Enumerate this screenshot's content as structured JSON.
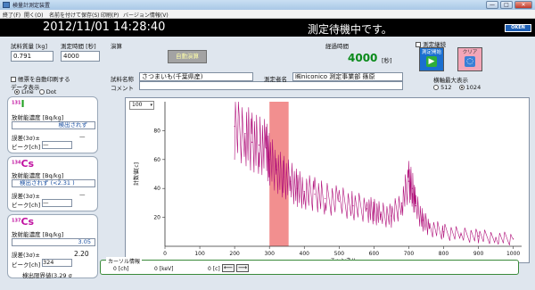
{
  "window": {
    "title": "検量計測定装置",
    "min_label": "—",
    "max_label": "□",
    "close_label": "✕"
  },
  "menu": [
    "終了(F)",
    "開く(O)",
    "名前を付けて保存(S)",
    "印刷(P)",
    "バージョン情報(V)"
  ],
  "banner": {
    "datetime": "2012/11/01 14:28:40",
    "status": "測定待機中です。",
    "logo": "OKEN"
  },
  "inputs": {
    "sample_mass_label": "試料質量 [kg]",
    "sample_mass_value": "0.791",
    "meas_time_label": "測定時間 [秒]",
    "meas_time_value": "4000",
    "calc_label": "演算",
    "auto_calc_button": "自動演算",
    "elapsed_label": "経過時間",
    "elapsed_value": "4000",
    "elapsed_unit": "[秒]",
    "continuous_label": "測定継続",
    "start_button": "測定開始",
    "clear_button": "クリア",
    "auto_save_label": "帳票を自動印刷する",
    "data_display_label": "データ表示",
    "line_label": "Line",
    "dot_label": "Dot",
    "sample_name_label": "試料名称",
    "sample_name_value": "さつまいも(千葉県産)",
    "operator_label": "測定者名",
    "operator_value": "㈱niconico 測定事業部 篠原",
    "comment_label": "コメント",
    "comment_value": "",
    "axis_max_label": "横軸最大表示",
    "axis_512": "512",
    "axis_1024": "1024"
  },
  "isotopes": [
    {
      "mass": "131",
      "element": "I",
      "conc_label": "放射能濃度 [Bq/kg]",
      "conc_value": "検出されず",
      "err_label": "誤差(3σ)±",
      "err_value": "—",
      "peak_label": "ピーク[ch]",
      "peak_value": "—",
      "color": "#20a020"
    },
    {
      "mass": "134",
      "element": "Cs",
      "conc_label": "放射能濃度 [Bq/kg]",
      "conc_value": "検出されず  (<2.31 )",
      "err_label": "誤差(3σ)±",
      "err_value": "—",
      "peak_label": "ピーク[ch]",
      "peak_value": "—",
      "color": "#c010a0"
    },
    {
      "mass": "137",
      "element": "Cs",
      "conc_label": "放射能濃度 [Bq/kg]",
      "conc_value": "3.05",
      "err_label": "誤差(3σ)±",
      "err_value": "2.20",
      "peak_label": "ピーク[ch]",
      "peak_value": "324",
      "detect_limit": "検出限界値(3.29 σ",
      "color": "#c010a0"
    }
  ],
  "chart_data": {
    "type": "line",
    "ymax_select": "100",
    "ylabel": "計数値[c]",
    "xlabel": "チャンネル",
    "xlim": [
      0,
      1024
    ],
    "ylim": [
      0,
      100
    ],
    "xticks": [
      0,
      100,
      200,
      300,
      400,
      500,
      600,
      700,
      800,
      900,
      1000
    ],
    "yticks": [
      20,
      40,
      60,
      80
    ],
    "highlight_range": [
      300,
      355
    ],
    "series_color": "#b0107a",
    "highlight_color": "#f07b7b",
    "x": [
      200,
      230,
      250,
      270,
      290,
      300,
      320,
      340,
      360,
      380,
      400,
      430,
      460,
      500,
      540,
      580,
      600,
      620,
      650,
      680,
      700,
      710,
      720,
      740,
      760,
      800,
      850,
      900,
      950,
      1000
    ],
    "y": [
      83,
      78,
      72,
      70,
      68,
      60,
      53,
      48,
      45,
      40,
      38,
      36,
      33,
      31,
      28,
      26,
      24,
      22,
      21,
      30,
      45,
      40,
      28,
      18,
      13,
      10,
      8,
      7,
      6,
      5
    ]
  },
  "cursor": {
    "title": "カーソル情報",
    "ch": "0 [ch]",
    "kev": "0 [keV]",
    "count": "0 [c]",
    "left": "⟵",
    "right": "⟶"
  }
}
